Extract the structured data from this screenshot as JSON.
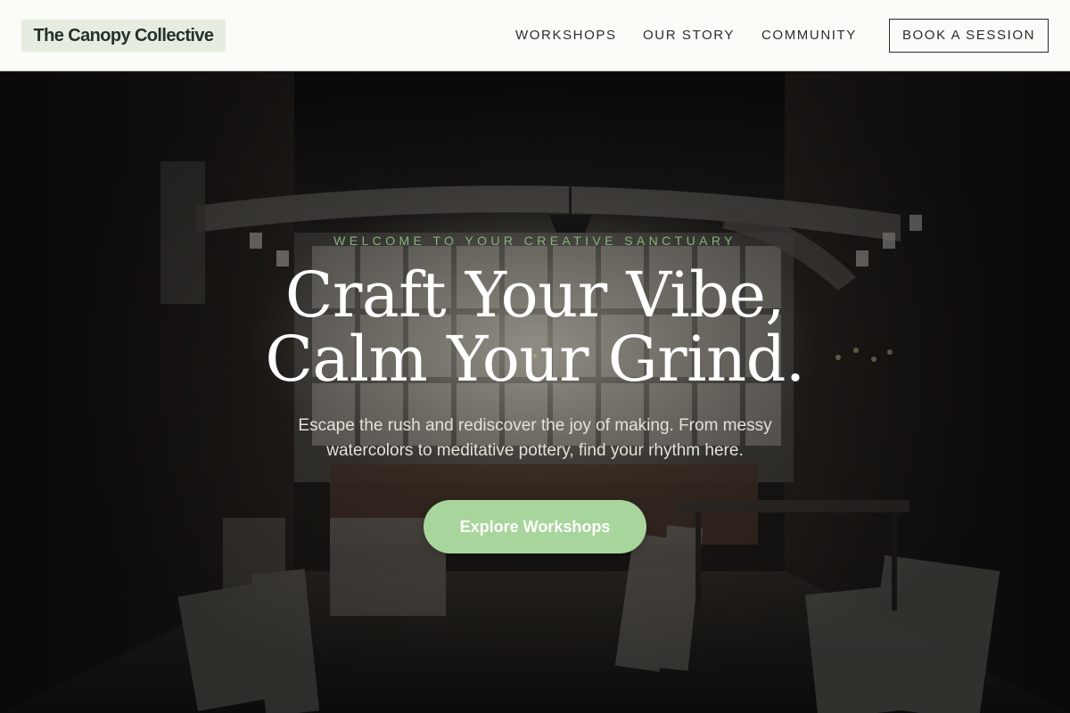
{
  "header": {
    "logo_text": "The Canopy Collective",
    "nav": [
      {
        "label": "WORKSHOPS"
      },
      {
        "label": "OUR STORY"
      },
      {
        "label": "COMMUNITY"
      }
    ],
    "cta_label": "BOOK A SESSION"
  },
  "hero": {
    "eyebrow": "WELCOME TO YOUR CREATIVE SANCTUARY",
    "headline_line1": "Craft Your Vibe,",
    "headline_line2": "Calm Your Grind.",
    "subtext": "Escape the rush and rediscover the joy of making. From messy watercolors to meditative pottery, find your rhythm here.",
    "cta_label": "Explore Workshops",
    "background_image": "dark art studio interior with canvases, pipes and large windows"
  },
  "colors": {
    "header_bg": "#fbfbf7",
    "logo_bg": "#e6ede0",
    "accent_green": "#a8d59b",
    "eyebrow_green": "#87b27b",
    "text_dark": "#2d2d2d"
  }
}
